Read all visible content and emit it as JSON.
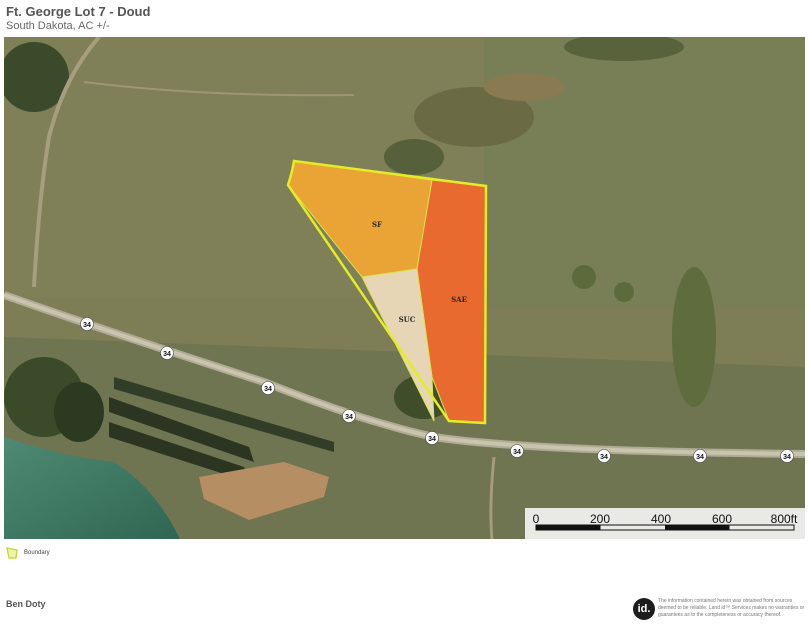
{
  "header": {
    "title": "Ft. George Lot 7 - Doud",
    "subtitle": "South Dakota,  AC +/-"
  },
  "map": {
    "parcel_labels": [
      "SF",
      "SAE",
      "SUC"
    ],
    "zone_colors": {
      "SF": "#eaa335",
      "SAE": "#e86a2e",
      "SUC": "#e7d6b6"
    },
    "boundary_color": "#e3ec26",
    "road_shield_label": "34",
    "scale_labels": [
      "0",
      "200",
      "400",
      "600",
      "800ft"
    ]
  },
  "legend": {
    "label": "Boundary",
    "color": "#c3d63a"
  },
  "footer": {
    "name": "Ben Doty",
    "logo_text": "id.",
    "disclaimer": "The information contained herein was obtained from sources deemed to be reliable. Land id™ Services makes no warranties or guarantees as to the completeness or accuracy thereof."
  }
}
